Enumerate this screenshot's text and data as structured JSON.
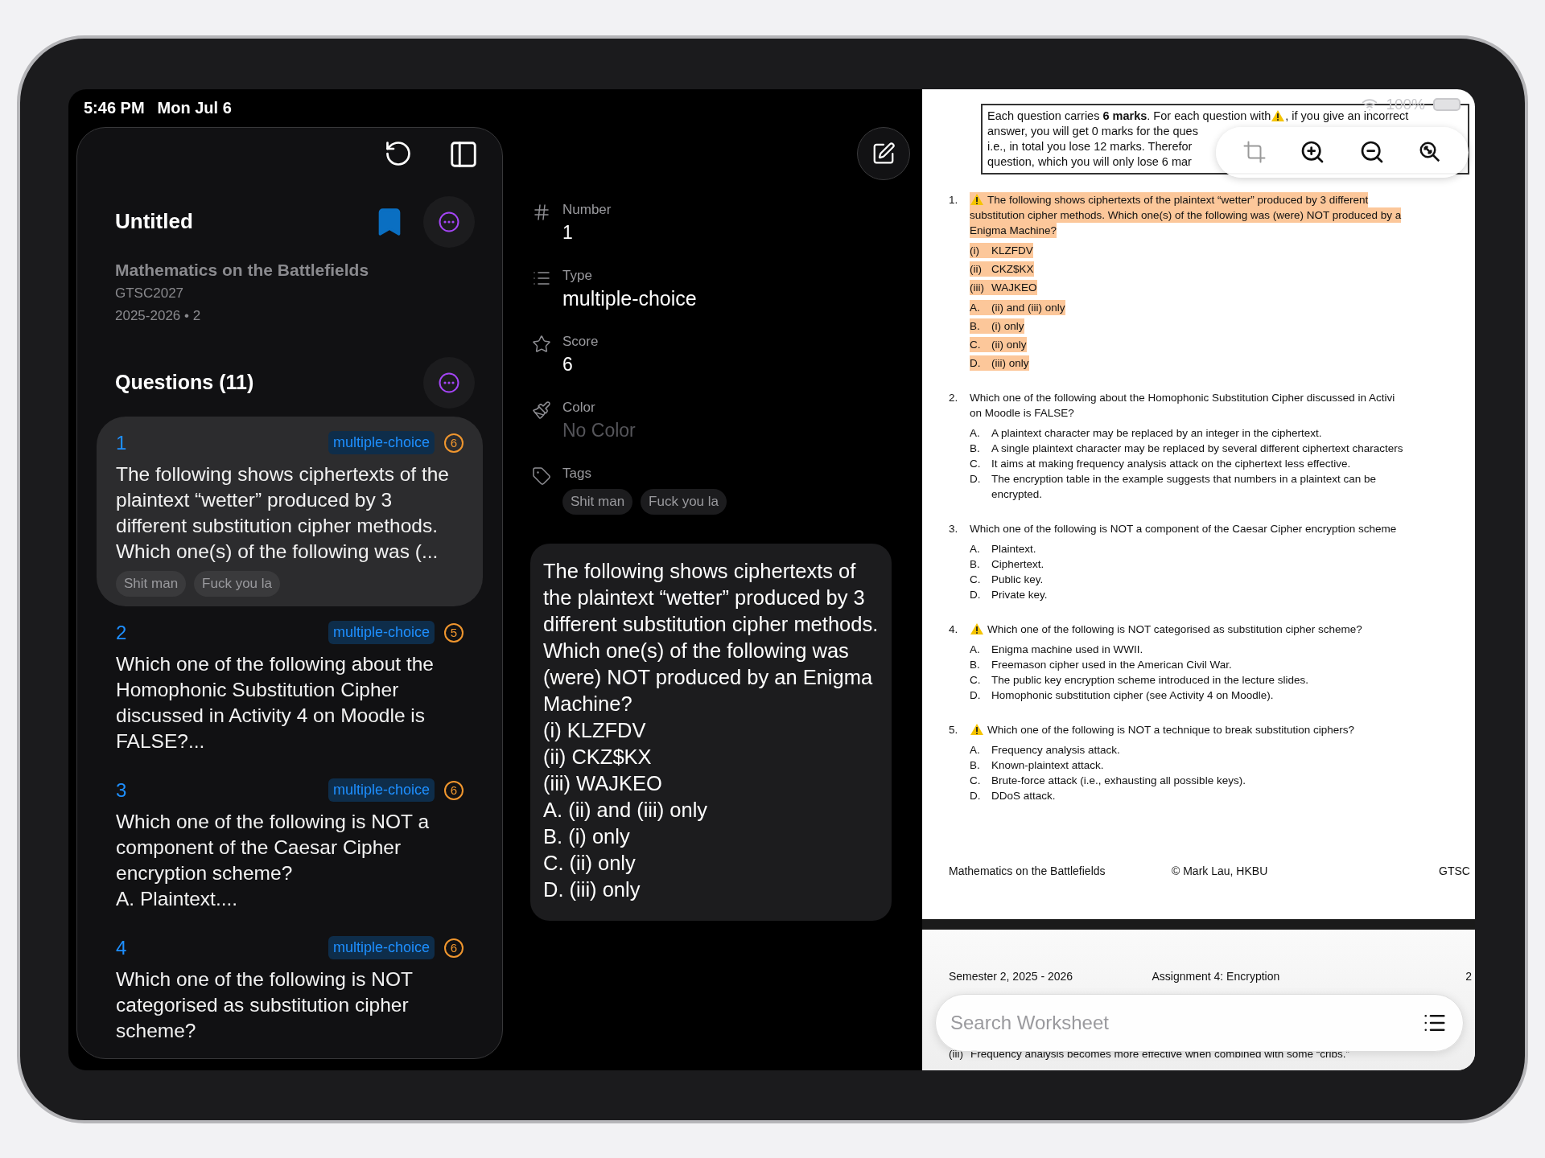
{
  "status_bar": {
    "time": "5:46 PM",
    "date": "Mon Jul 6",
    "battery": "100%"
  },
  "sidebar": {
    "title": "Untitled",
    "bookmarked": true,
    "course": "Mathematics on the Battlefields",
    "code": "GTSC2027",
    "term": "2025-2026 • 2",
    "questions_heading": "Questions (11)",
    "questions": [
      {
        "number": "1",
        "type": "multiple-choice",
        "score": "6",
        "selected": true,
        "text": "The following shows ciphertexts of the plaintext “wetter” produced by 3 different substitution cipher methods. Which one(s) of the following was (...",
        "tags": [
          "Shit man",
          "Fuck you la"
        ]
      },
      {
        "number": "2",
        "type": "multiple-choice",
        "score": "5",
        "selected": false,
        "text": "Which one of the following about the Homophonic Substitution Cipher discussed in Activity 4 on Moodle is FALSE?..."
      },
      {
        "number": "3",
        "type": "multiple-choice",
        "score": "6",
        "selected": false,
        "text": "Which one of the following is NOT a component of the Caesar Cipher encryption scheme?\nA. Plaintext...."
      },
      {
        "number": "4",
        "type": "multiple-choice",
        "score": "6",
        "selected": false,
        "text": "Which one of the following is NOT categorised as substitution cipher scheme?"
      }
    ]
  },
  "detail": {
    "fields": [
      {
        "kind": "number",
        "label": "Number",
        "value": "1",
        "empty": false
      },
      {
        "kind": "type",
        "label": "Type",
        "value": "multiple-choice",
        "empty": false
      },
      {
        "kind": "score",
        "label": "Score",
        "value": "6",
        "empty": false
      },
      {
        "kind": "color",
        "label": "Color",
        "value": "No Color",
        "empty": true
      },
      {
        "kind": "tags",
        "label": "Tags",
        "tags": [
          "Shit man",
          "Fuck you la"
        ]
      }
    ],
    "question_text": "The following shows ciphertexts of the plaintext “wetter” produced by 3 different substitution cipher methods. Which one(s) of the following was (were) NOT produced by an Enigma Machine?\n(i) KLZFDV\n(ii) CKZ$KX\n(iii) WAJKEO\nA. (ii) and (iii) only\nB. (i) only\nC. (ii) only\nD. (iii) only"
  },
  "document": {
    "notice": [
      "Each question carries **6 marks**. For each question with",
      ", if you give an incorrect",
      "answer, you will get 0 marks for the ques",
      "i.e., in total you lose 12 marks. Therefor",
      "question, which you will only lose 6 mar"
    ],
    "questions": [
      {
        "number": "1.",
        "warning": true,
        "highlighted": true,
        "stem": [
          "The following shows ciphertexts of the plaintext “wetter” produced by 3 different",
          "substitution cipher methods. Which one(s) of the following was (were) NOT produced by a",
          "Enigma Machine?"
        ],
        "groups": [
          [
            {
              "label": "(i)",
              "lines": [
                "KLZFDV"
              ]
            },
            {
              "label": "(ii)",
              "lines": [
                "CKZ$KX"
              ]
            },
            {
              "label": "(iii)",
              "lines": [
                "WAJKEO"
              ]
            }
          ],
          [
            {
              "label": "A.",
              "lines": [
                "(ii) and (iii) only"
              ]
            },
            {
              "label": "B.",
              "lines": [
                "(i) only"
              ]
            },
            {
              "label": "C.",
              "lines": [
                "(ii) only"
              ]
            },
            {
              "label": "D.",
              "lines": [
                "(iii) only"
              ]
            }
          ]
        ]
      },
      {
        "number": "2.",
        "warning": false,
        "highlighted": false,
        "stem": [
          "Which one of the following about the Homophonic Substitution Cipher discussed in Activi",
          "on Moodle is FALSE?"
        ],
        "groups": [
          [
            {
              "label": "A.",
              "lines": [
                "A plaintext character may be replaced by an integer in the ciphertext."
              ]
            },
            {
              "label": "B.",
              "lines": [
                "A single plaintext character may be replaced by several different ciphertext characters"
              ]
            },
            {
              "label": "C.",
              "lines": [
                "It aims at making frequency analysis attack on the ciphertext less effective."
              ]
            },
            {
              "label": "D.",
              "lines": [
                "The encryption table in the example suggests that numbers in a plaintext can be",
                "encrypted."
              ]
            }
          ]
        ]
      },
      {
        "number": "3.",
        "warning": false,
        "highlighted": false,
        "stem": [
          "Which one of the following is NOT a component of the Caesar Cipher encryption scheme"
        ],
        "groups": [
          [
            {
              "label": "A.",
              "lines": [
                "Plaintext."
              ]
            },
            {
              "label": "B.",
              "lines": [
                "Ciphertext."
              ]
            },
            {
              "label": "C.",
              "lines": [
                "Public key."
              ]
            },
            {
              "label": "D.",
              "lines": [
                "Private key."
              ]
            }
          ]
        ]
      },
      {
        "number": "4.",
        "warning": true,
        "highlighted": false,
        "stem": [
          "Which one of the following is NOT categorised as substitution cipher scheme?"
        ],
        "groups": [
          [
            {
              "label": "A.",
              "lines": [
                "Enigma machine used in WWII."
              ]
            },
            {
              "label": "B.",
              "lines": [
                "Freemason cipher used in the American Civil War."
              ]
            },
            {
              "label": "C.",
              "lines": [
                "The public key encryption scheme introduced in the lecture slides."
              ]
            },
            {
              "label": "D.",
              "lines": [
                "Homophonic substitution cipher (see Activity 4 on Moodle)."
              ]
            }
          ]
        ]
      },
      {
        "number": "5.",
        "warning": true,
        "highlighted": false,
        "stem": [
          "Which one of the following is NOT a technique to break substitution ciphers?"
        ],
        "groups": [
          [
            {
              "label": "A.",
              "lines": [
                "Frequency analysis attack."
              ]
            },
            {
              "label": "B.",
              "lines": [
                "Known-plaintext attack."
              ]
            },
            {
              "label": "C.",
              "lines": [
                "Brute-force attack (i.e., exhausting all possible keys)."
              ]
            },
            {
              "label": "D.",
              "lines": [
                "DDoS attack."
              ]
            }
          ]
        ]
      }
    ],
    "footer": [
      "Mathematics on the Battlefields",
      "© Mark Lau, HKBU",
      "GTSC"
    ],
    "next_header": [
      "Semester 2, 2025 - 2026",
      "Assignment 4: Encryption",
      "2"
    ],
    "next_line": {
      "label": "(iii)",
      "text": "Frequency analysis becomes more effective when combined with some “cribs.”"
    },
    "search": {
      "placeholder": "Search Worksheet"
    }
  }
}
